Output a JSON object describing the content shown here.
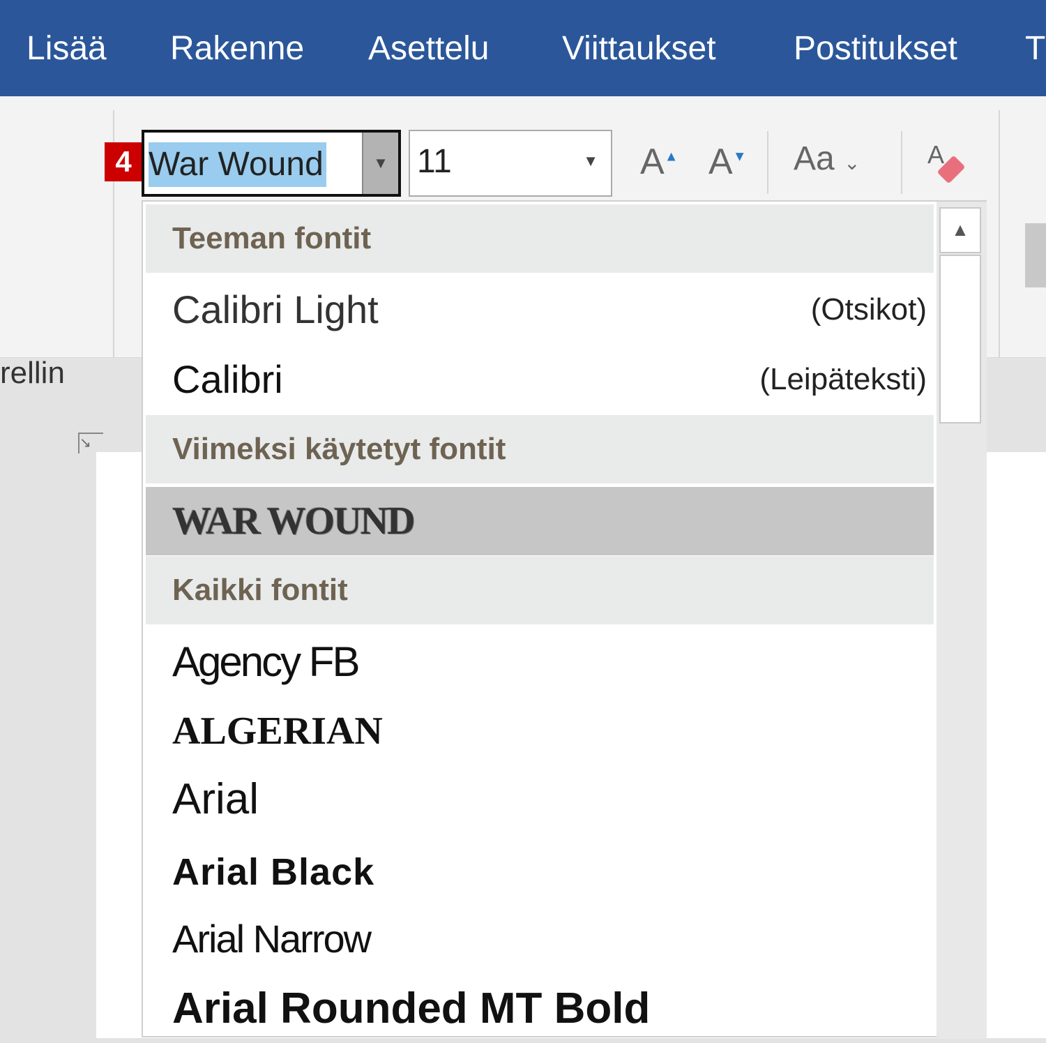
{
  "tabs": [
    "Lisää",
    "Rakenne",
    "Asettelu",
    "Viittaukset",
    "Postitukset",
    "T"
  ],
  "ribbon": {
    "partial_label": "rellin",
    "step_badge": "4",
    "font_name": "War Wound",
    "font_size": "11",
    "grow_font": "A",
    "shrink_font": "A",
    "change_case": "Aa",
    "change_case_arrow": "⌄"
  },
  "dropdown": {
    "sections": {
      "theme": "Teeman fontit",
      "recent": "Viimeksi käytetyt fontit",
      "all": "Kaikki fontit"
    },
    "theme_fonts": [
      {
        "name": "Calibri Light",
        "hint": "(Otsikot)"
      },
      {
        "name": "Calibri",
        "hint": "(Leipäteksti)"
      }
    ],
    "recent_fonts": [
      "WAR WOUND"
    ],
    "all_fonts": [
      "Agency FB",
      "ALGERIAN",
      "Arial",
      "Arial Black",
      "Arial Narrow",
      "Arial Rounded MT Bold"
    ]
  }
}
